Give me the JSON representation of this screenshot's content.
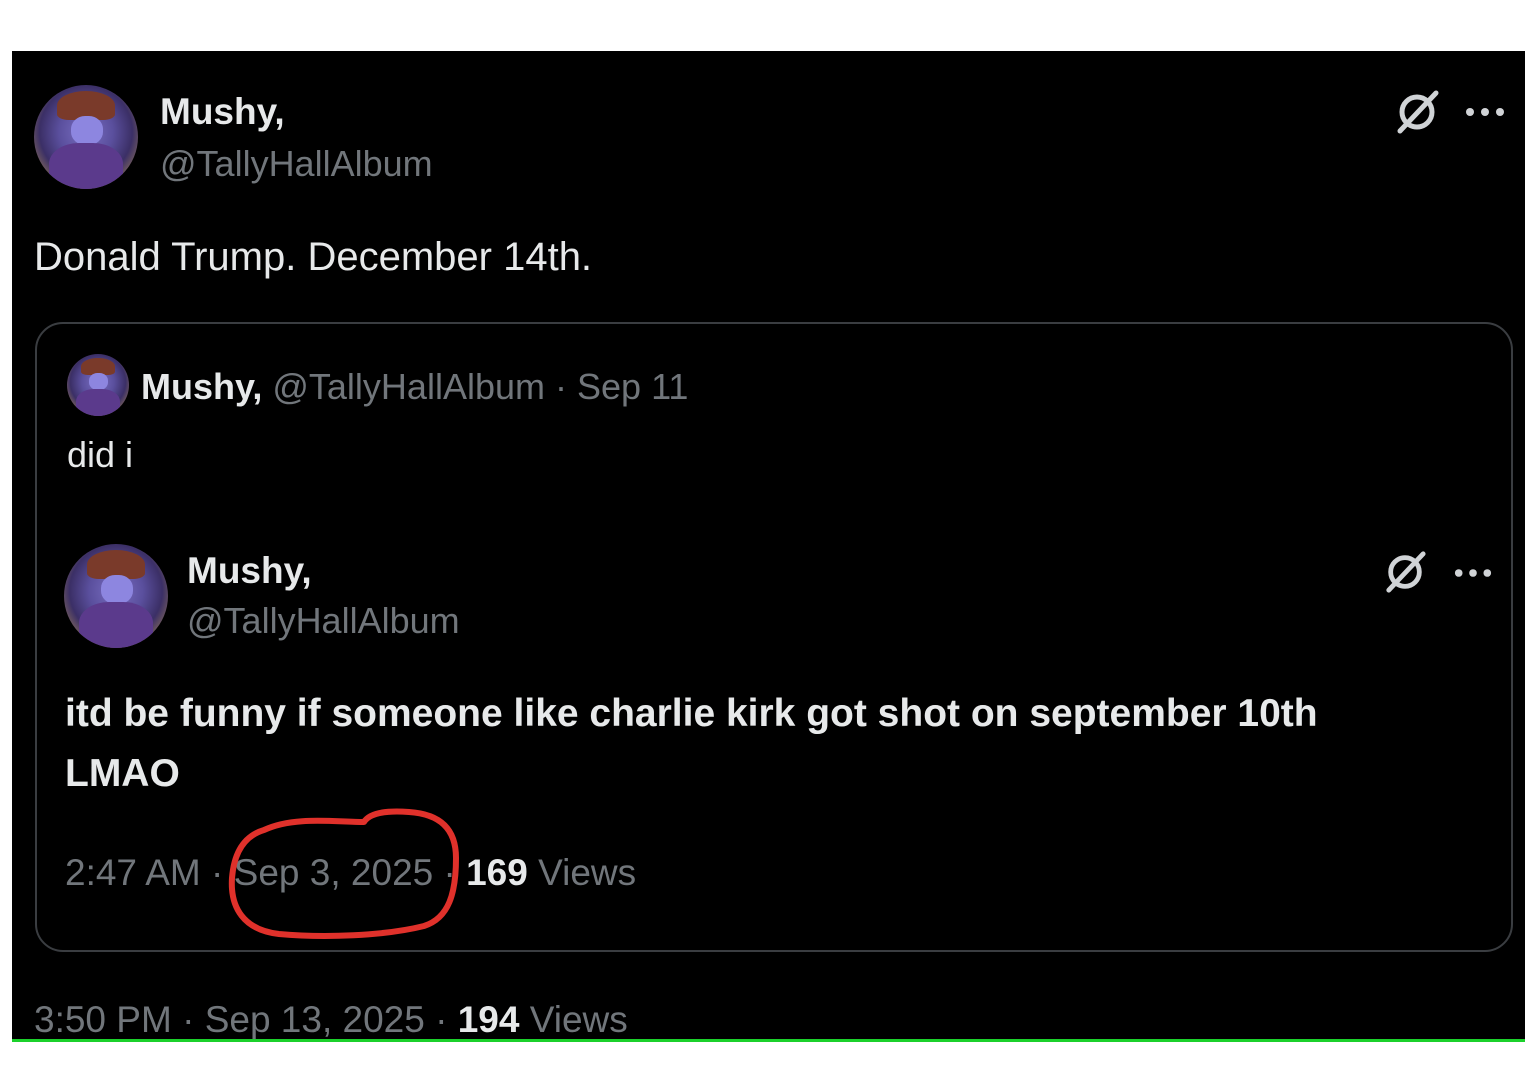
{
  "main_post": {
    "display_name": "Mushy,",
    "handle": "@TallyHallAlbum",
    "text": "Donald Trump. December 14th.",
    "time": "3:50 PM",
    "date": "Sep 13, 2025",
    "views_count": "194",
    "views_label": "Views",
    "sep": "·"
  },
  "quoted_post": {
    "display_name": "Mushy,",
    "handle": "@TallyHallAlbum",
    "date_short": "Sep 11",
    "sep": "·",
    "text": "did i"
  },
  "embedded_post": {
    "display_name": "Mushy,",
    "handle": "@TallyHallAlbum",
    "text_line1": "itd be funny if someone like charlie kirk got shot on september 10th",
    "text_line2": "LMAO",
    "time": "2:47 AM",
    "date": "Sep 3, 2025",
    "views_count": "169",
    "views_label": "Views",
    "sep": "·"
  },
  "icons": {
    "grok": "grok-icon",
    "more": "more-icon"
  },
  "colors": {
    "background": "#000000",
    "primary_text": "#e7e9ea",
    "secondary_text": "#71767b",
    "annotation": "#e0312b"
  }
}
